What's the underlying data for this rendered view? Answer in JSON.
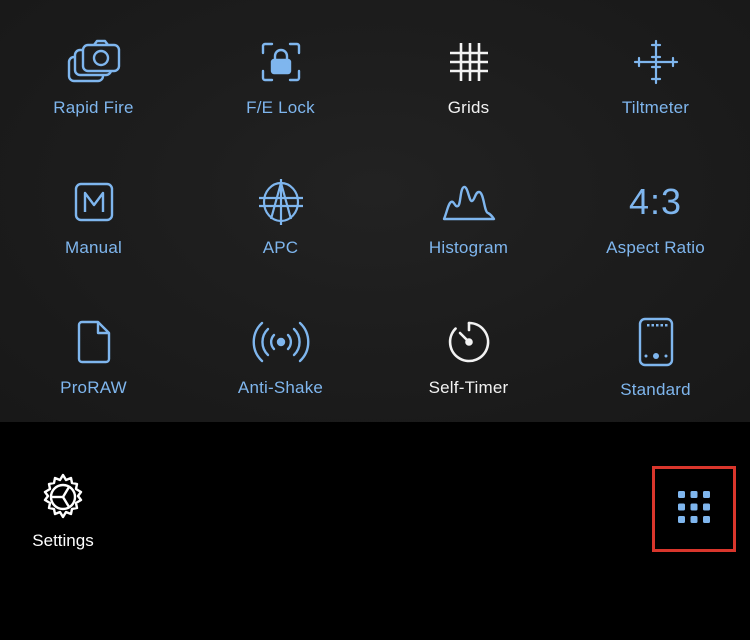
{
  "tiles": [
    {
      "label": "Rapid Fire",
      "icon": "rapid-fire-icon",
      "active": false
    },
    {
      "label": "F/E Lock",
      "icon": "lock-icon",
      "active": false
    },
    {
      "label": "Grids",
      "icon": "grid-icon",
      "active": true
    },
    {
      "label": "Tiltmeter",
      "icon": "tiltmeter-icon",
      "active": false
    },
    {
      "label": "Manual",
      "icon": "manual-icon",
      "active": false
    },
    {
      "label": "APC",
      "icon": "apc-icon",
      "active": false
    },
    {
      "label": "Histogram",
      "icon": "histogram-icon",
      "active": false
    },
    {
      "label": "Aspect Ratio",
      "icon": "aspect-ratio-icon",
      "active": false,
      "icon_text": "4:3"
    },
    {
      "label": "ProRAW",
      "icon": "document-icon",
      "active": false
    },
    {
      "label": "Anti-Shake",
      "icon": "anti-shake-icon",
      "active": false
    },
    {
      "label": "Self-Timer",
      "icon": "timer-icon",
      "active": true
    },
    {
      "label": "Standard",
      "icon": "phone-frame-icon",
      "active": false
    }
  ],
  "bottom": {
    "settings_label": "Settings",
    "settings_icon": "gear-icon",
    "grid_button_icon": "apps-grid-icon"
  },
  "colors": {
    "accent": "#7fb6ee",
    "active": "#f2f2f2",
    "highlight_border": "#d9362c"
  }
}
